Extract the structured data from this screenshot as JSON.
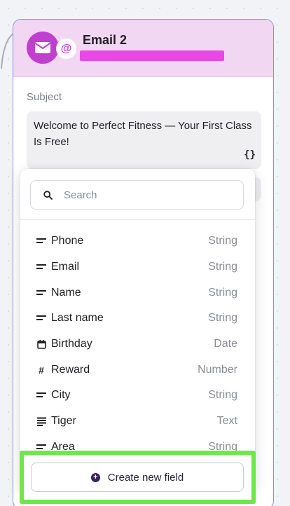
{
  "card": {
    "title": "Email 2",
    "at_badge": "@"
  },
  "subject": {
    "label": "Subject",
    "value": "Welcome to Perfect Fitness — Your First Class Is Free!",
    "variable_icon": "{}"
  },
  "dropdown": {
    "search_placeholder": "Search",
    "fields": [
      {
        "icon": "text-lines-icon",
        "name": "Phone",
        "type": "String"
      },
      {
        "icon": "text-lines-icon",
        "name": "Email",
        "type": "String"
      },
      {
        "icon": "text-lines-icon",
        "name": "Name",
        "type": "String"
      },
      {
        "icon": "text-lines-icon",
        "name": "Last name",
        "type": "String"
      },
      {
        "icon": "calendar-icon",
        "name": "Birthday",
        "type": "Date"
      },
      {
        "icon": "hash-icon",
        "name": "Reward",
        "type": "Number"
      },
      {
        "icon": "text-lines-icon",
        "name": "City",
        "type": "String"
      },
      {
        "icon": "paragraph-icon",
        "name": "Tiger",
        "type": "Text"
      },
      {
        "icon": "text-lines-icon",
        "name": "Area",
        "type": "String"
      }
    ],
    "create_label": "Create new field"
  },
  "colors": {
    "accent": "#c13fcf",
    "header_bg": "#f2d7f3",
    "highlight": "#6ee74a",
    "card_border": "#7f8fe6"
  }
}
